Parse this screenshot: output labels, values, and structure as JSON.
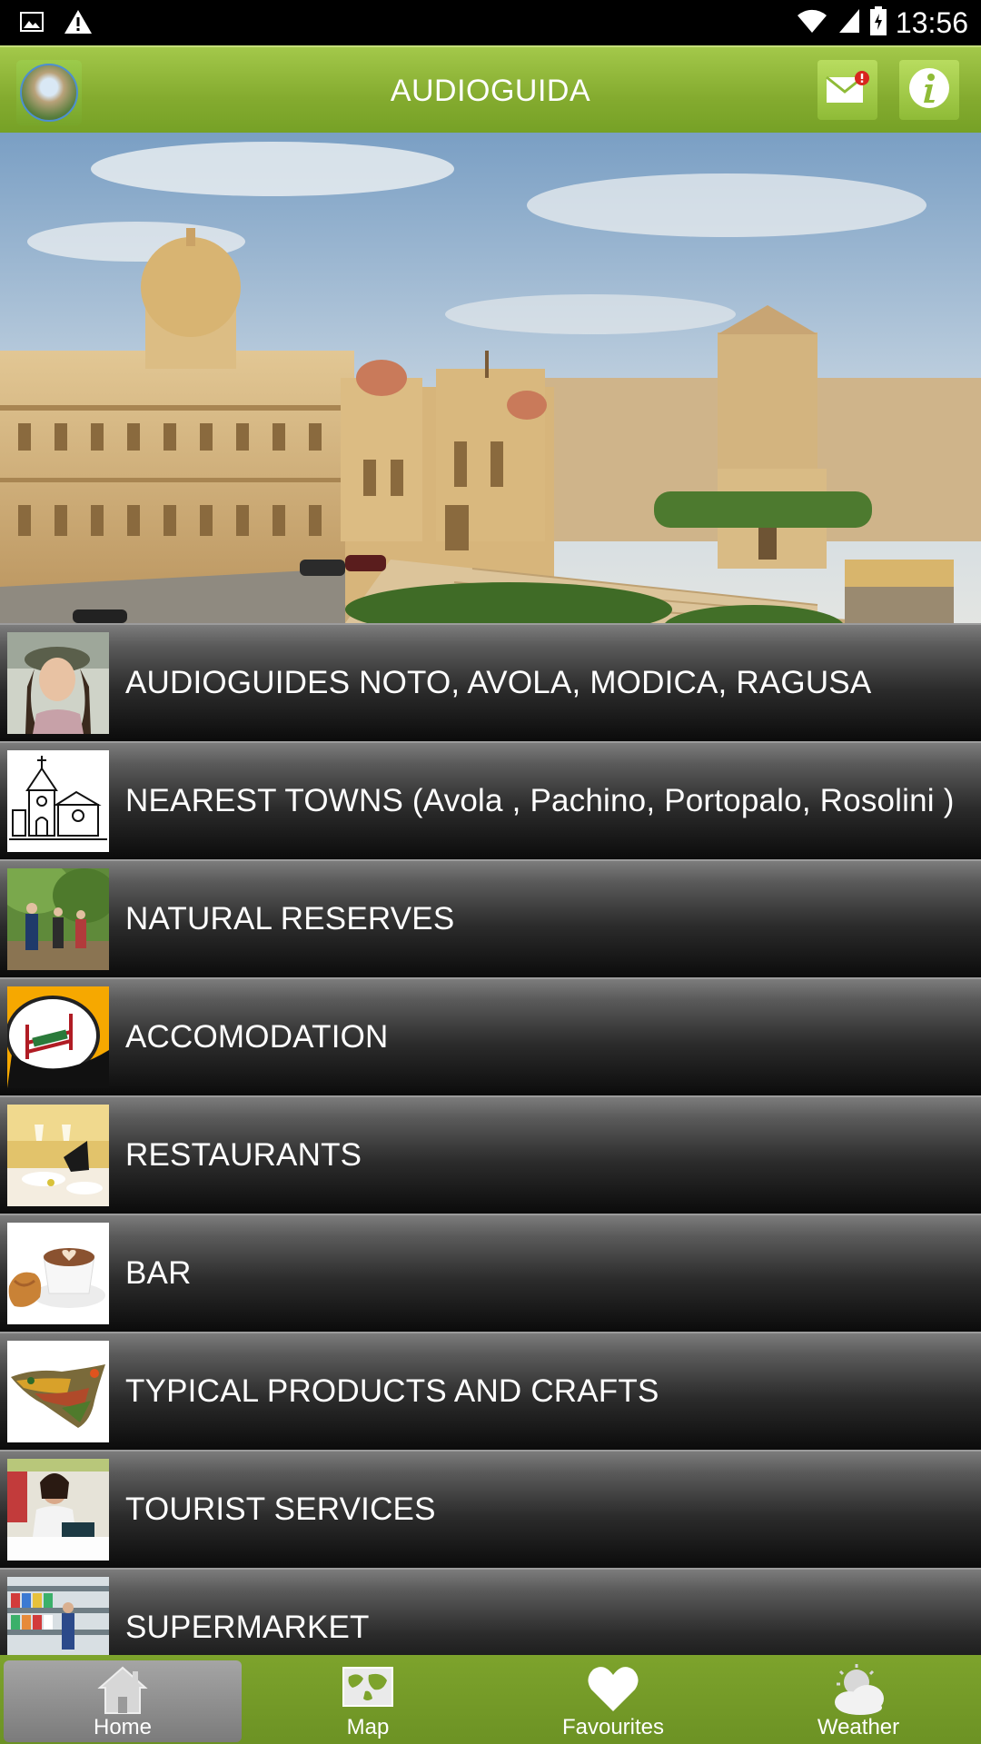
{
  "status_bar": {
    "time": "13:56",
    "icons": [
      "image-icon",
      "warning-icon",
      "wifi-icon",
      "signal-icon",
      "battery-icon"
    ]
  },
  "app_bar": {
    "title": "AUDIOGUIDA",
    "logo_icon": "app-logo",
    "mail_icon": "mail-notification-icon",
    "info_icon": "info-icon",
    "accent_color": "#8ab535"
  },
  "menu": {
    "items": [
      {
        "label": "AUDIOGUIDES NOTO, AVOLA, MODICA, RAGUSA",
        "thumb": "audioguide-girl-thumb"
      },
      {
        "label": "NEAREST TOWNS (Avola , Pachino, Portopalo, Rosolini )",
        "thumb": "church-sketch-thumb"
      },
      {
        "label": "NATURAL RESERVES",
        "thumb": "hikers-thumb"
      },
      {
        "label": "ACCOMODATION",
        "thumb": "bed-logo-thumb"
      },
      {
        "label": "RESTAURANTS",
        "thumb": "table-setting-thumb"
      },
      {
        "label": "BAR",
        "thumb": "coffee-croissant-thumb"
      },
      {
        "label": "TYPICAL PRODUCTS AND CRAFTS",
        "thumb": "sicily-map-thumb"
      },
      {
        "label": "TOURIST SERVICES",
        "thumb": "receptionist-thumb"
      },
      {
        "label": "SUPERMARKET",
        "thumb": "supermarket-shelves-thumb"
      }
    ]
  },
  "bottom_nav": {
    "items": [
      {
        "label": "Home",
        "icon": "home-icon"
      },
      {
        "label": "Map",
        "icon": "map-icon"
      },
      {
        "label": "Favourites",
        "icon": "heart-icon"
      },
      {
        "label": "Weather",
        "icon": "weather-icon"
      }
    ]
  }
}
